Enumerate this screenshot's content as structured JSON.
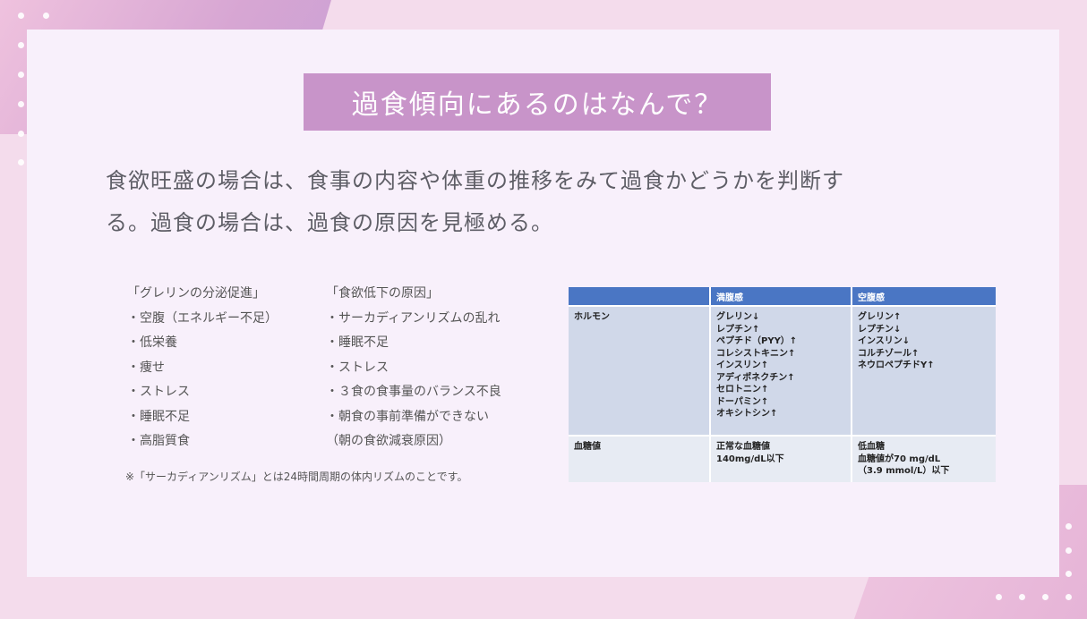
{
  "title": "過食傾向にあるのはなんで？",
  "lead": {
    "line1": "食欲旺盛の場合は、食事の内容や体重の推移をみて過食かどうかを判断す",
    "line2": "る。過食の場合は、過食の原因を見極める。"
  },
  "ghrelin": {
    "heading": "「グレリンの分泌促進」",
    "items": [
      "・空腹（エネルギー不足）",
      "・低栄養",
      "・痩せ",
      "・ストレス",
      "・睡眠不足",
      "・高脂質食"
    ]
  },
  "appetite_loss": {
    "heading": "「食欲低下の原因」",
    "items": [
      "・サーカディアンリズムの乱れ",
      "・睡眠不足",
      "・ストレス",
      "・３食の食事量のバランス不良",
      "・朝食の事前準備ができない",
      "（朝の食欲減衰原因）"
    ]
  },
  "note": "※「サーカディアンリズム」とは24時間周期の体内リズムのことです。",
  "table": {
    "headers": [
      "",
      "満腹感",
      "空腹感"
    ],
    "rows": [
      {
        "label": "ホルモン",
        "full": [
          "グレリン↓",
          "レプチン↑",
          "ペプチド（PYY）↑",
          "コレシストキニン↑",
          "インスリン↑",
          "アディポネクチン↑",
          "セロトニン↑",
          "ドーパミン↑",
          "オキシトシン↑"
        ],
        "hungry": [
          "グレリン↑",
          "レプチン↓",
          "インスリン↓",
          "コルチゾール↑",
          "ネウロペプチドY↑"
        ]
      },
      {
        "label": "血糖値",
        "full": [
          "正常な血糖値",
          "140mg/dL以下"
        ],
        "hungry": [
          "低血糖",
          "血糖値が70 mg/dL",
          "（3.9 mmol/L）以下"
        ]
      }
    ]
  },
  "colors": {
    "title_bg": "#c894c9",
    "table_header": "#4a76c4",
    "table_row1": "#d0d8e9",
    "table_row2": "#e7ebf3",
    "slide_bg": "#f8f0fb"
  }
}
